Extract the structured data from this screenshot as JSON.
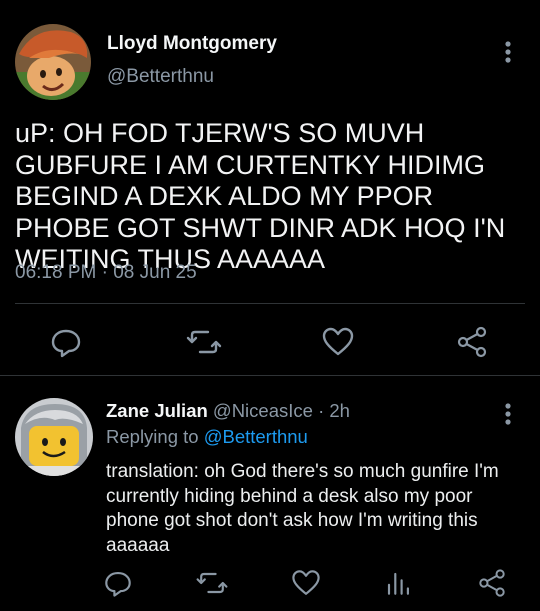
{
  "main_tweet": {
    "author_name": "Lloyd Montgomery",
    "author_handle": "@Betterthnu",
    "text": "uP: OH FOD TJERW'S SO MUVH GUBFURE I AM CURTENTKY HIDIMG BEGIND A DEXK ALDO MY PPOR PHOBE GOT SHWT DINR ADK HOQ I'N WEITING THUS AAAAAA",
    "time": "06:18 PM",
    "separator": "·",
    "date": "08 Jun 25",
    "icons": [
      "more-vertical-icon",
      "reply-icon",
      "retweet-icon",
      "like-icon",
      "share-icon"
    ]
  },
  "reply": {
    "author_name": "Zane Julian",
    "author_handle": "@NiceasIce",
    "separator": "·",
    "age": "2h",
    "replying_to_label": "Replying to",
    "replying_to_handle": "@Betterthnu",
    "text": "translation: oh God there's so much gunfire I'm currently hiding behind a desk also my poor phone got shot don't ask how I'm writing this aaaaaa",
    "icons": [
      "more-vertical-icon",
      "reply-icon",
      "retweet-icon",
      "like-icon",
      "views-icon",
      "share-icon"
    ]
  },
  "colors": {
    "background": "#000000",
    "text": "#e7e9ea",
    "muted": "#8b98a5",
    "link": "#1d9bf0",
    "divider": "#2f3336"
  }
}
